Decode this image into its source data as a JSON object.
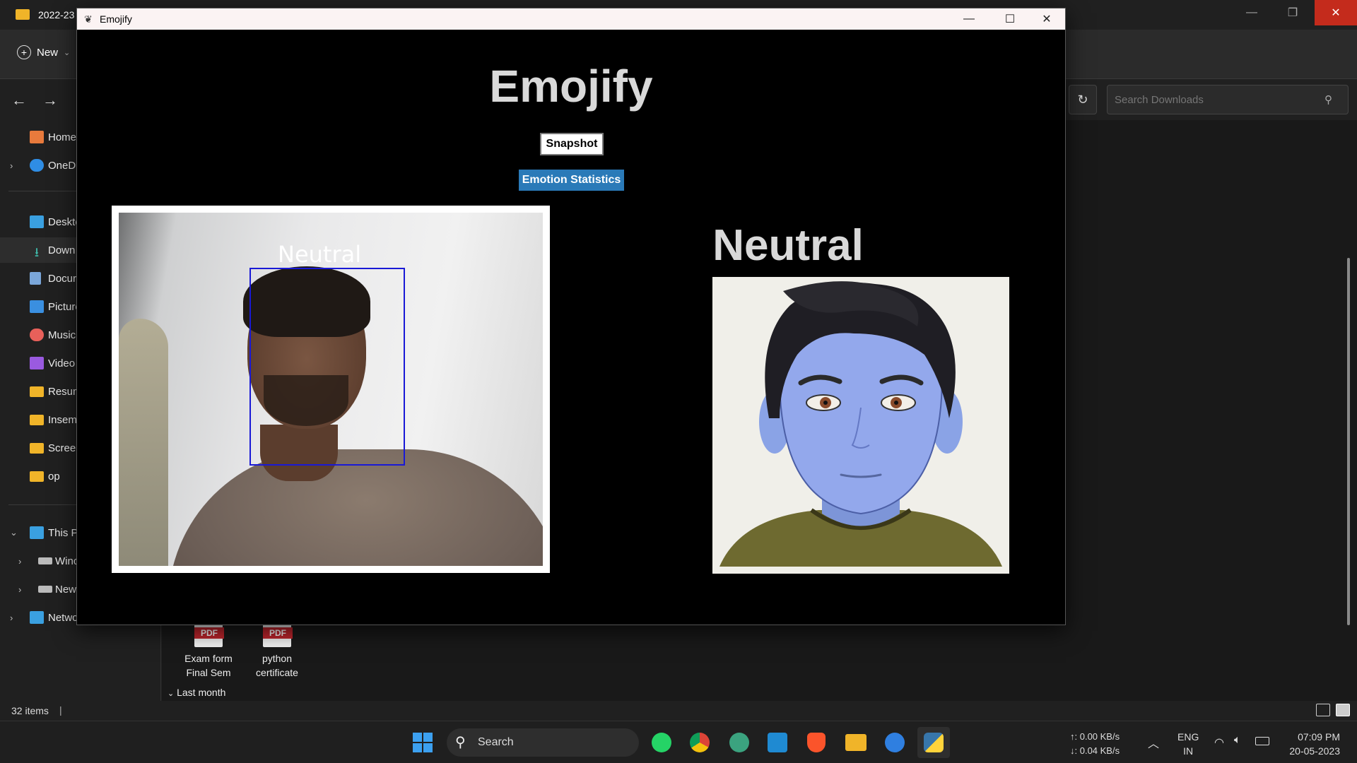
{
  "explorer": {
    "title": "2022-23",
    "new_label": "New",
    "search_placeholder": "Search Downloads",
    "sidebar": [
      {
        "label": "Home",
        "color": "#e87a3c"
      },
      {
        "label": "OneDr",
        "color": "#2f8de4"
      },
      {
        "label": "Deskto",
        "color": "#3aa0e0"
      },
      {
        "label": "Down",
        "color": "#3fb8a8"
      },
      {
        "label": "Docur",
        "color": "#7aa6d9"
      },
      {
        "label": "Picture",
        "color": "#3a8fe0"
      },
      {
        "label": "Music",
        "color": "#e8605a"
      },
      {
        "label": "Video",
        "color": "#9a5ae0"
      },
      {
        "label": "Resum",
        "color": "#f0b429"
      },
      {
        "label": "Insem",
        "color": "#f0b429"
      },
      {
        "label": "Screer",
        "color": "#f0b429"
      },
      {
        "label": "op",
        "color": "#f0b429"
      },
      {
        "label": "This P",
        "color": "#3aa0e0"
      },
      {
        "label": "Winc",
        "color": "#bbbbbb"
      },
      {
        "label": "New",
        "color": "#bbbbbb"
      },
      {
        "label": "Netwo",
        "color": "#3aa0e0"
      }
    ],
    "files": [
      {
        "badge": "PDF",
        "line1": "Exam form",
        "line2": "Final Sem"
      },
      {
        "badge": "PDF",
        "line1": "python",
        "line2": "certificate"
      }
    ],
    "group_header": "Last month",
    "status_count": "32 items"
  },
  "emojify": {
    "window_title": "Emojify",
    "heading": "Emojify",
    "snapshot_label": "Snapshot",
    "stats_label": "Emotion Statistics",
    "detected_label": "Neutral",
    "emotion_text": "Neutral",
    "accent_color": "#2a7ab8",
    "face_box_color": "#1919d6"
  },
  "taskbar": {
    "search_label": "Search",
    "upload_speed": "↑: 0.00 KB/s",
    "download_speed": "↓: 0.04 KB/s",
    "lang1": "ENG",
    "lang2": "IN",
    "time": "07:09 PM",
    "date": "20-05-2023"
  }
}
